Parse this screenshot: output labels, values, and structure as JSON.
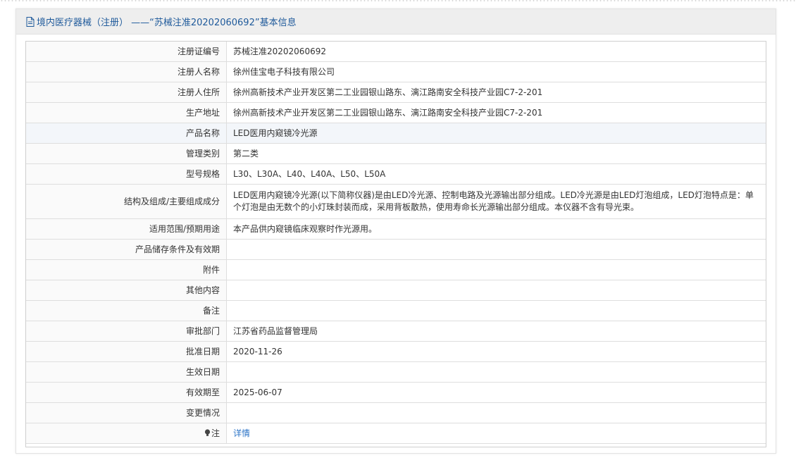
{
  "header": {
    "title": "境内医疗器械（注册） ——“苏械注准20202060692”基本信息",
    "icon": "document-icon"
  },
  "rows": [
    {
      "label": "注册证编号",
      "value": "苏械注准20202060692"
    },
    {
      "label": "注册人名称",
      "value": "徐州佳宝电子科技有限公司"
    },
    {
      "label": "注册人住所",
      "value": "徐州高新技术产业开发区第二工业园银山路东、漓江路南安全科技产业园C7-2-201"
    },
    {
      "label": "生产地址",
      "value": "徐州高新技术产业开发区第二工业园银山路东、漓江路南安全科技产业园C7-2-201"
    },
    {
      "label": "产品名称",
      "value": "LED医用内窥镜冷光源"
    },
    {
      "label": "管理类别",
      "value": "第二类"
    },
    {
      "label": "型号规格",
      "value": "L30、L30A、L40、L40A、L50、L50A"
    },
    {
      "label": "结构及组成/主要组成成分",
      "value": "LED医用内窥镜冷光源(以下简称仪器)是由LED冷光源、控制电路及光源输出部分组成。LED冷光源是由LED灯泡组成，LED灯泡特点是：单个灯泡是由无数个的小灯珠封装而成，采用背板散热，使用寿命长光源输出部分组成。本仪器不含有导光束。"
    },
    {
      "label": "适用范围/预期用途",
      "value": "本产品供内窥镜临床观察时作光源用。"
    },
    {
      "label": "产品储存条件及有效期",
      "value": ""
    },
    {
      "label": "附件",
      "value": ""
    },
    {
      "label": "其他内容",
      "value": ""
    },
    {
      "label": "备注",
      "value": ""
    },
    {
      "label": "审批部门",
      "value": "江苏省药品监督管理局"
    },
    {
      "label": "批准日期",
      "value": "2020-11-26"
    },
    {
      "label": "生效日期",
      "value": ""
    },
    {
      "label": "有效期至",
      "value": "2025-06-07"
    },
    {
      "label": "变更情况",
      "value": ""
    }
  ],
  "note": {
    "label": "注",
    "icon": "lightbulb-icon",
    "link_text": "详情"
  },
  "colors": {
    "header_text": "#1f5a9b",
    "link": "#2c74c7",
    "header_bg": "#eeeeee",
    "highlight_row": "#f3f6fa"
  }
}
